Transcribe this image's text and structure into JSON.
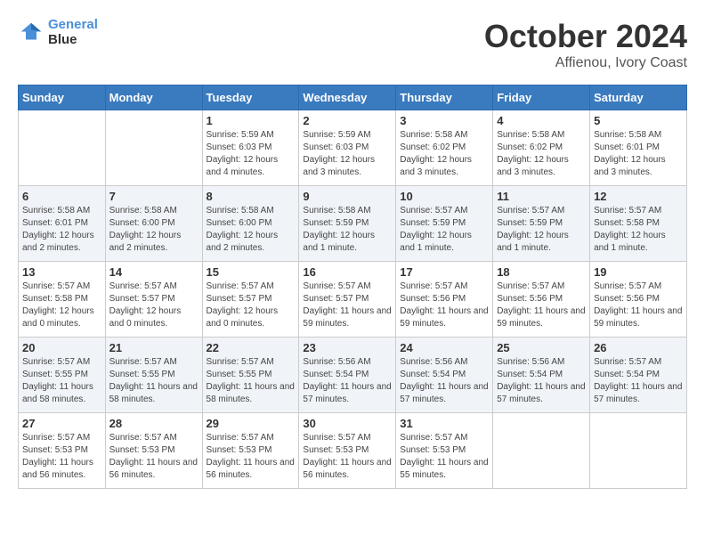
{
  "header": {
    "logo_line1": "General",
    "logo_line2": "Blue",
    "month": "October 2024",
    "location": "Affienou, Ivory Coast"
  },
  "weekdays": [
    "Sunday",
    "Monday",
    "Tuesday",
    "Wednesday",
    "Thursday",
    "Friday",
    "Saturday"
  ],
  "weeks": [
    [
      {
        "day": "",
        "info": ""
      },
      {
        "day": "",
        "info": ""
      },
      {
        "day": "1",
        "info": "Sunrise: 5:59 AM\nSunset: 6:03 PM\nDaylight: 12 hours and 4 minutes."
      },
      {
        "day": "2",
        "info": "Sunrise: 5:59 AM\nSunset: 6:03 PM\nDaylight: 12 hours and 3 minutes."
      },
      {
        "day": "3",
        "info": "Sunrise: 5:58 AM\nSunset: 6:02 PM\nDaylight: 12 hours and 3 minutes."
      },
      {
        "day": "4",
        "info": "Sunrise: 5:58 AM\nSunset: 6:02 PM\nDaylight: 12 hours and 3 minutes."
      },
      {
        "day": "5",
        "info": "Sunrise: 5:58 AM\nSunset: 6:01 PM\nDaylight: 12 hours and 3 minutes."
      }
    ],
    [
      {
        "day": "6",
        "info": "Sunrise: 5:58 AM\nSunset: 6:01 PM\nDaylight: 12 hours and 2 minutes."
      },
      {
        "day": "7",
        "info": "Sunrise: 5:58 AM\nSunset: 6:00 PM\nDaylight: 12 hours and 2 minutes."
      },
      {
        "day": "8",
        "info": "Sunrise: 5:58 AM\nSunset: 6:00 PM\nDaylight: 12 hours and 2 minutes."
      },
      {
        "day": "9",
        "info": "Sunrise: 5:58 AM\nSunset: 5:59 PM\nDaylight: 12 hours and 1 minute."
      },
      {
        "day": "10",
        "info": "Sunrise: 5:57 AM\nSunset: 5:59 PM\nDaylight: 12 hours and 1 minute."
      },
      {
        "day": "11",
        "info": "Sunrise: 5:57 AM\nSunset: 5:59 PM\nDaylight: 12 hours and 1 minute."
      },
      {
        "day": "12",
        "info": "Sunrise: 5:57 AM\nSunset: 5:58 PM\nDaylight: 12 hours and 1 minute."
      }
    ],
    [
      {
        "day": "13",
        "info": "Sunrise: 5:57 AM\nSunset: 5:58 PM\nDaylight: 12 hours and 0 minutes."
      },
      {
        "day": "14",
        "info": "Sunrise: 5:57 AM\nSunset: 5:57 PM\nDaylight: 12 hours and 0 minutes."
      },
      {
        "day": "15",
        "info": "Sunrise: 5:57 AM\nSunset: 5:57 PM\nDaylight: 12 hours and 0 minutes."
      },
      {
        "day": "16",
        "info": "Sunrise: 5:57 AM\nSunset: 5:57 PM\nDaylight: 11 hours and 59 minutes."
      },
      {
        "day": "17",
        "info": "Sunrise: 5:57 AM\nSunset: 5:56 PM\nDaylight: 11 hours and 59 minutes."
      },
      {
        "day": "18",
        "info": "Sunrise: 5:57 AM\nSunset: 5:56 PM\nDaylight: 11 hours and 59 minutes."
      },
      {
        "day": "19",
        "info": "Sunrise: 5:57 AM\nSunset: 5:56 PM\nDaylight: 11 hours and 59 minutes."
      }
    ],
    [
      {
        "day": "20",
        "info": "Sunrise: 5:57 AM\nSunset: 5:55 PM\nDaylight: 11 hours and 58 minutes."
      },
      {
        "day": "21",
        "info": "Sunrise: 5:57 AM\nSunset: 5:55 PM\nDaylight: 11 hours and 58 minutes."
      },
      {
        "day": "22",
        "info": "Sunrise: 5:57 AM\nSunset: 5:55 PM\nDaylight: 11 hours and 58 minutes."
      },
      {
        "day": "23",
        "info": "Sunrise: 5:56 AM\nSunset: 5:54 PM\nDaylight: 11 hours and 57 minutes."
      },
      {
        "day": "24",
        "info": "Sunrise: 5:56 AM\nSunset: 5:54 PM\nDaylight: 11 hours and 57 minutes."
      },
      {
        "day": "25",
        "info": "Sunrise: 5:56 AM\nSunset: 5:54 PM\nDaylight: 11 hours and 57 minutes."
      },
      {
        "day": "26",
        "info": "Sunrise: 5:57 AM\nSunset: 5:54 PM\nDaylight: 11 hours and 57 minutes."
      }
    ],
    [
      {
        "day": "27",
        "info": "Sunrise: 5:57 AM\nSunset: 5:53 PM\nDaylight: 11 hours and 56 minutes."
      },
      {
        "day": "28",
        "info": "Sunrise: 5:57 AM\nSunset: 5:53 PM\nDaylight: 11 hours and 56 minutes."
      },
      {
        "day": "29",
        "info": "Sunrise: 5:57 AM\nSunset: 5:53 PM\nDaylight: 11 hours and 56 minutes."
      },
      {
        "day": "30",
        "info": "Sunrise: 5:57 AM\nSunset: 5:53 PM\nDaylight: 11 hours and 56 minutes."
      },
      {
        "day": "31",
        "info": "Sunrise: 5:57 AM\nSunset: 5:53 PM\nDaylight: 11 hours and 55 minutes."
      },
      {
        "day": "",
        "info": ""
      },
      {
        "day": "",
        "info": ""
      }
    ]
  ]
}
